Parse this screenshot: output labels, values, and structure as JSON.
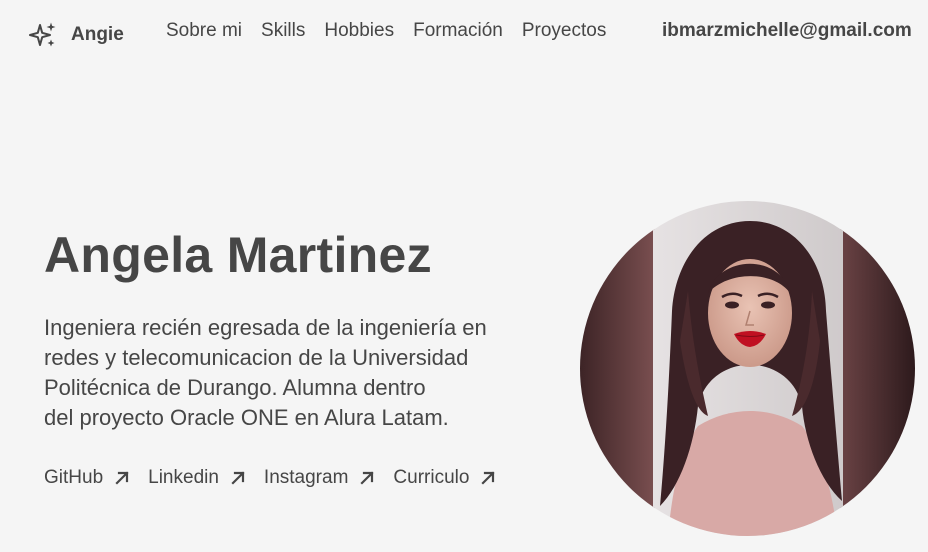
{
  "nav": {
    "brand": "Angie",
    "brand_icon": "sparkles-icon",
    "links": [
      "Sobre mi",
      "Skills",
      "Hobbies",
      "Formación",
      "Proyectos"
    ],
    "email": "ibmarzmichelle@gmail.com"
  },
  "hero": {
    "name": "Angela Martinez",
    "description_lines": [
      "Ingeniera recién egresada de la ingeniería en",
      "redes y telecomunicacion de la Universidad",
      "Politécnica de Durango. Alumna dentro",
      "del proyecto Oracle ONE en Alura Latam."
    ],
    "links": [
      {
        "label": "GitHub",
        "icon": "arrow-up-right-icon"
      },
      {
        "label": "Linkedin",
        "icon": "arrow-up-right-icon"
      },
      {
        "label": "Instagram",
        "icon": "arrow-up-right-icon"
      },
      {
        "label": "Curriculo",
        "icon": "arrow-up-right-icon"
      }
    ],
    "photo": "profile-photo"
  },
  "colors": {
    "background": "#f5f5f5",
    "text": "#464646"
  }
}
